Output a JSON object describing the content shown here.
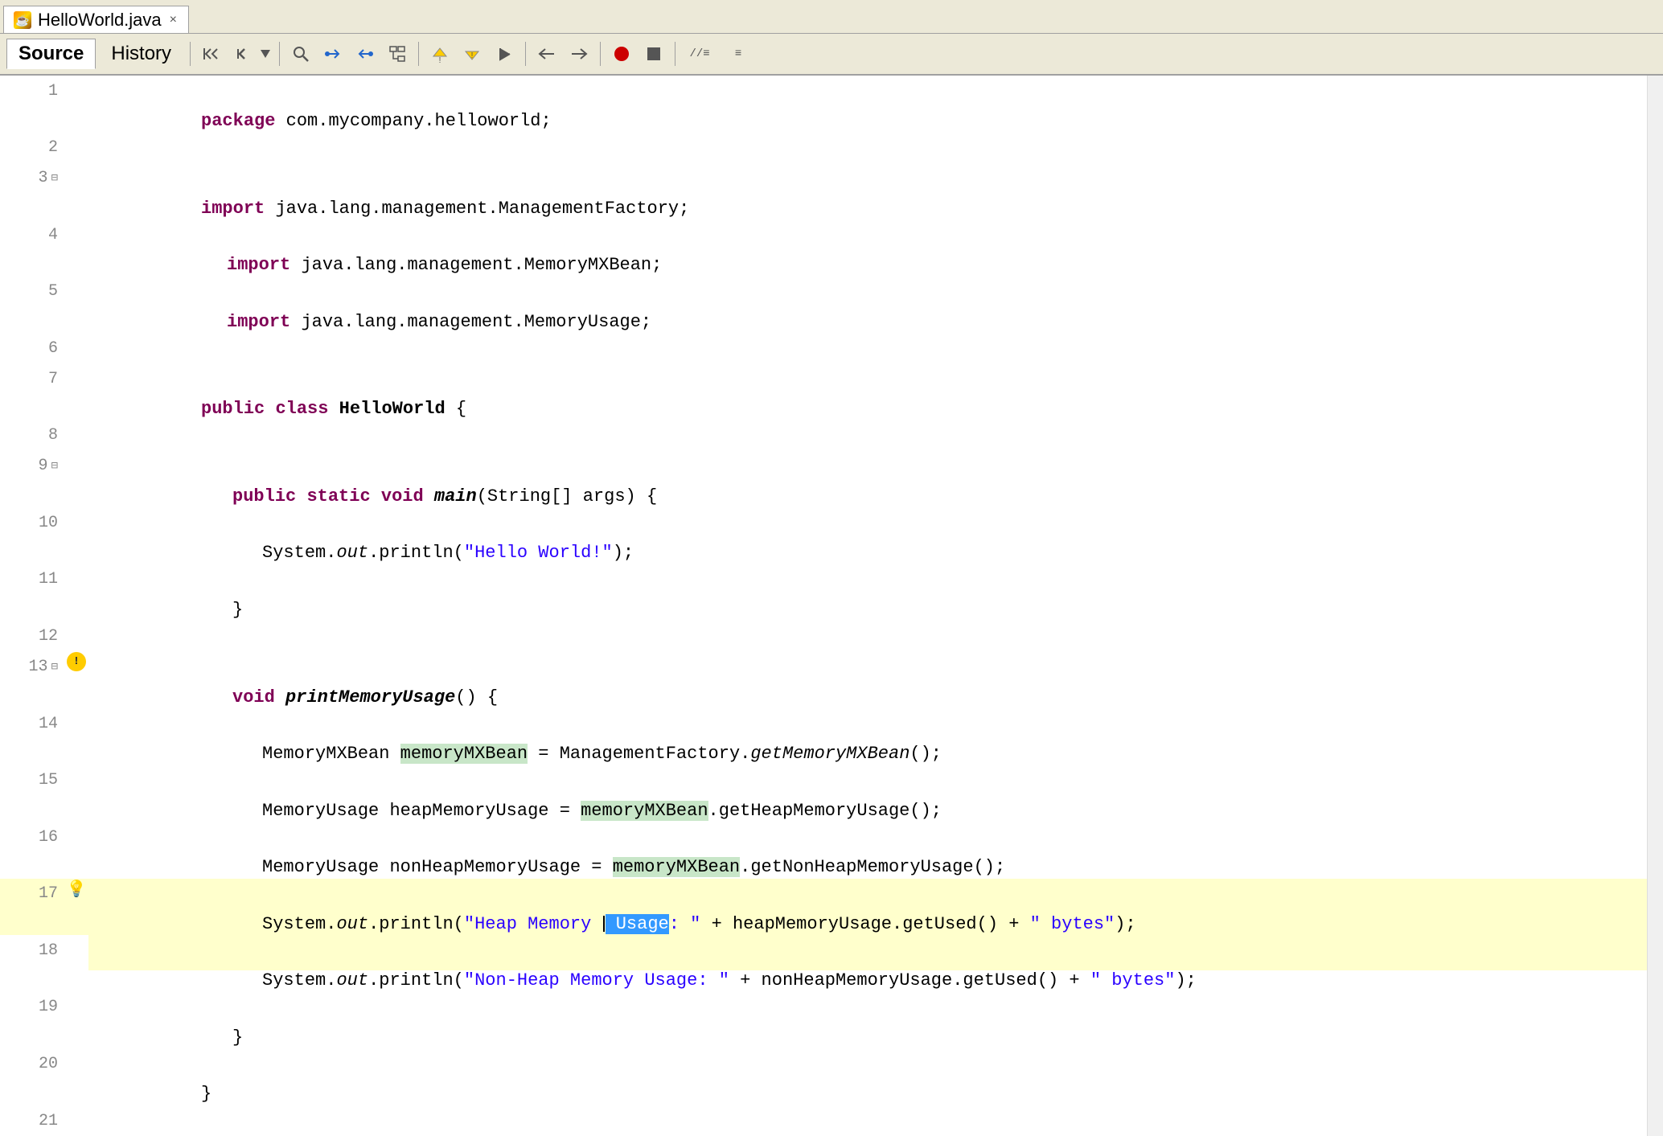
{
  "tab": {
    "icon": "J",
    "label": "HelloWorld.java",
    "close_label": "×"
  },
  "toolbar": {
    "source_label": "Source",
    "history_label": "History",
    "buttons": [
      {
        "name": "back-to-previous",
        "icon": "⏮",
        "label": "Back to Previous Edit"
      },
      {
        "name": "forward",
        "icon": "▶",
        "label": "Forward"
      },
      {
        "name": "dropdown",
        "icon": "▼",
        "label": "Dropdown"
      },
      {
        "name": "separator1",
        "icon": "|"
      },
      {
        "name": "search",
        "icon": "🔍",
        "label": "Search"
      },
      {
        "name": "nav-back",
        "icon": "◀",
        "label": "Navigate Back"
      },
      {
        "name": "nav-forward",
        "icon": "▶",
        "label": "Navigate Forward"
      },
      {
        "name": "open-call-hierarchy",
        "icon": "⬛",
        "label": "Open Call Hierarchy"
      },
      {
        "name": "separator2",
        "icon": "|"
      },
      {
        "name": "prev-annotation",
        "icon": "↑",
        "label": "Previous Annotation"
      },
      {
        "name": "next-annotation",
        "icon": "↓",
        "label": "Next Annotation"
      },
      {
        "name": "last-edit",
        "icon": "↙",
        "label": "Last Edit Location"
      },
      {
        "name": "separator3",
        "icon": "|"
      },
      {
        "name": "nav-back2",
        "icon": "⇐",
        "label": "Nav Back"
      },
      {
        "name": "nav-fwd2",
        "icon": "⇒",
        "label": "Nav Forward"
      },
      {
        "name": "separator4",
        "icon": "|"
      },
      {
        "name": "breakpoint",
        "icon": "●",
        "label": "Toggle Breakpoint",
        "color": "#cc0000"
      },
      {
        "name": "stop",
        "icon": "■",
        "label": "Stop"
      },
      {
        "name": "separator5",
        "icon": "|"
      },
      {
        "name": "comment",
        "icon": "//≡",
        "label": "Toggle Comment"
      },
      {
        "name": "uncomment",
        "icon": "≡",
        "label": "Toggle Uncomment"
      }
    ]
  },
  "lines": [
    {
      "num": 1,
      "indent": 0,
      "tokens": [
        {
          "text": "package ",
          "class": "kw"
        },
        {
          "text": "com.mycompany.helloworld;",
          "class": ""
        }
      ]
    },
    {
      "num": 2,
      "indent": 0,
      "tokens": []
    },
    {
      "num": 3,
      "indent": 0,
      "fold": true,
      "tokens": [
        {
          "text": "import ",
          "class": "kw"
        },
        {
          "text": "java.lang.management.ManagementFactory;",
          "class": ""
        }
      ]
    },
    {
      "num": 4,
      "indent": 0,
      "tokens": [
        {
          "text": "import ",
          "class": "kw"
        },
        {
          "text": "java.lang.management.MemoryMXBean;",
          "class": ""
        }
      ]
    },
    {
      "num": 5,
      "indent": 0,
      "tokens": [
        {
          "text": "import ",
          "class": "kw"
        },
        {
          "text": "java.lang.management.MemoryUsage;",
          "class": ""
        }
      ]
    },
    {
      "num": 6,
      "indent": 0,
      "tokens": []
    },
    {
      "num": 7,
      "indent": 0,
      "tokens": [
        {
          "text": "public ",
          "class": "kw"
        },
        {
          "text": "class ",
          "class": "kw"
        },
        {
          "text": "HelloWorld",
          "class": "type-bold"
        },
        {
          "text": " {",
          "class": ""
        }
      ]
    },
    {
      "num": 8,
      "indent": 0,
      "tokens": []
    },
    {
      "num": 9,
      "indent": 1,
      "fold": true,
      "tokens": [
        {
          "text": "    public ",
          "class": "kw"
        },
        {
          "text": "static ",
          "class": "kw"
        },
        {
          "text": "void ",
          "class": "kw"
        },
        {
          "text": "main",
          "class": "method-bold"
        },
        {
          "text": "(String[] args) {",
          "class": ""
        }
      ]
    },
    {
      "num": 10,
      "indent": 2,
      "tokens": [
        {
          "text": "        System.",
          "class": ""
        },
        {
          "text": "out",
          "class": "method"
        },
        {
          "text": ".println(",
          "class": ""
        },
        {
          "text": "\"Hello World!\"",
          "class": "string"
        },
        {
          "text": ");",
          "class": ""
        }
      ]
    },
    {
      "num": 11,
      "indent": 1,
      "tokens": [
        {
          "text": "    }",
          "class": ""
        }
      ]
    },
    {
      "num": 12,
      "indent": 0,
      "tokens": []
    },
    {
      "num": 13,
      "indent": 1,
      "fold": true,
      "warning": true,
      "tokens": [
        {
          "text": "    void ",
          "class": "kw"
        },
        {
          "text": "printMemoryUsage",
          "class": "method-bold"
        },
        {
          "text": "() {",
          "class": ""
        }
      ]
    },
    {
      "num": 14,
      "indent": 2,
      "highlight": true,
      "tokens": [
        {
          "text": "        MemoryMXBean ",
          "class": ""
        },
        {
          "text": "memoryMXBean",
          "class": "highlight-bg-text"
        },
        {
          "text": " = ManagementFactory.",
          "class": ""
        },
        {
          "text": "getMemoryMXBean",
          "class": "method"
        },
        {
          "text": "();",
          "class": ""
        }
      ]
    },
    {
      "num": 15,
      "indent": 2,
      "tokens": [
        {
          "text": "        MemoryUsage heapMemoryUsage = ",
          "class": ""
        },
        {
          "text": "memoryMXBean",
          "class": "highlight-bg-text"
        },
        {
          "text": ".getHeapMemoryUsage();",
          "class": ""
        }
      ]
    },
    {
      "num": 16,
      "indent": 2,
      "tokens": [
        {
          "text": "        MemoryUsage nonHeapMemoryUsage = ",
          "class": ""
        },
        {
          "text": "memoryMXBean",
          "class": "highlight-bg-text"
        },
        {
          "text": ".getNonHeapMemoryUsage();",
          "class": ""
        }
      ]
    },
    {
      "num": 17,
      "indent": 2,
      "lightbulb": true,
      "highlight_yellow": true,
      "tokens": [
        {
          "text": "        System.",
          "class": ""
        },
        {
          "text": "out",
          "class": "method"
        },
        {
          "text": ".println(",
          "class": ""
        },
        {
          "text": "\"Heap Memory ",
          "class": "string"
        },
        {
          "text": "| Usage",
          "class": "string-selected"
        },
        {
          "text": ": \"",
          "class": "string"
        },
        {
          "text": " + heapMemoryUsage.getUsed() + ",
          "class": ""
        },
        {
          "text": "\" bytes\"",
          "class": "string"
        },
        {
          "text": ");",
          "class": ""
        }
      ]
    },
    {
      "num": 18,
      "indent": 2,
      "tokens": [
        {
          "text": "        System.",
          "class": ""
        },
        {
          "text": "out",
          "class": "method"
        },
        {
          "text": ".println(",
          "class": ""
        },
        {
          "text": "\"Non-Heap Memory Usage: \"",
          "class": "string"
        },
        {
          "text": " + nonHeapMemoryUsage.getUsed() + ",
          "class": ""
        },
        {
          "text": "\" bytes\"",
          "class": "string"
        },
        {
          "text": ");",
          "class": ""
        }
      ]
    },
    {
      "num": 19,
      "indent": 1,
      "tokens": [
        {
          "text": "    }",
          "class": ""
        }
      ]
    },
    {
      "num": 20,
      "indent": 0,
      "tokens": [
        {
          "text": "}",
          "class": ""
        }
      ]
    },
    {
      "num": 21,
      "indent": 0,
      "tokens": []
    }
  ]
}
